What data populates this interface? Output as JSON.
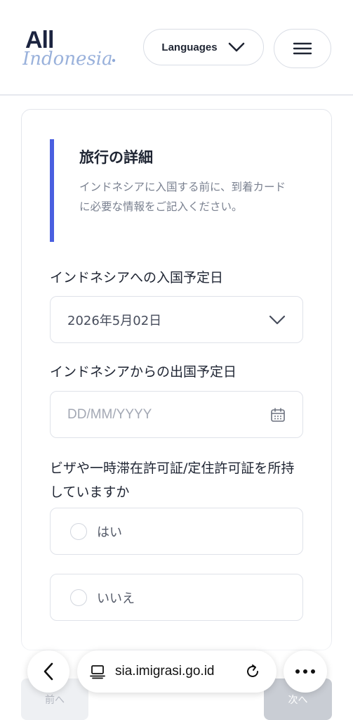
{
  "header": {
    "logo_text_1": "All",
    "logo_text_2": "Indonesia",
    "languages_label": "Languages",
    "accent": "#4a5fe0"
  },
  "section": {
    "title": "旅行の詳細",
    "description": "インドネシアに入国する前に、到着カードに必要な情報をご記入ください。"
  },
  "form": {
    "arrival_label": "インドネシアへの入国予定日",
    "arrival_value": "2026年5月02日",
    "departure_label": "インドネシアからの出国予定日",
    "departure_placeholder": "DD/MM/YYYY",
    "visa_question": "ビザや一時滞在許可証/定住許可証を所持していますか",
    "options": [
      "はい",
      "いいえ"
    ]
  },
  "footer": {
    "prev_label": "前へ",
    "next_label": "次へ"
  },
  "browser": {
    "url": "sia.imigrasi.go.id"
  },
  "icons": {
    "lang_chevron": "chevron-down-icon",
    "menu": "hamburger-icon",
    "date_chevron": "chevron-down-icon",
    "calendar": "calendar-icon",
    "back": "chevron-left-icon",
    "tabs": "tabs-icon",
    "reload": "reload-icon",
    "more": "more-horizontal-icon"
  }
}
